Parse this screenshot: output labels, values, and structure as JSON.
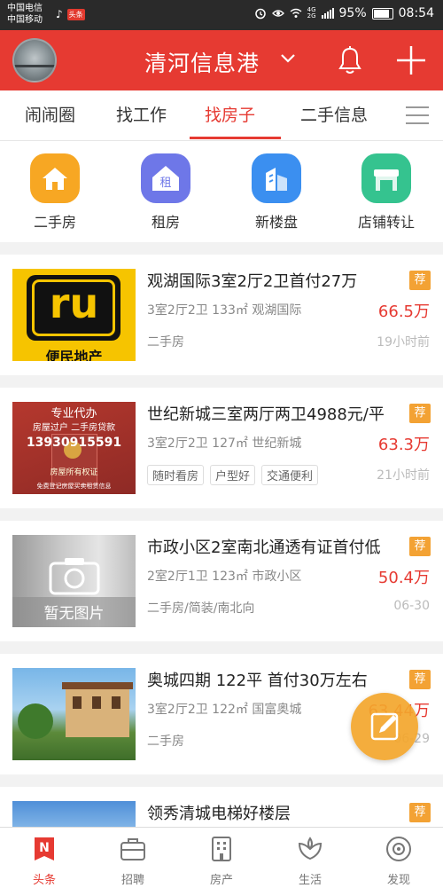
{
  "status_bar": {
    "carrier1": "中国电信",
    "carrier2": "中国移动",
    "app_badge": "头条",
    "net1": "4G",
    "net2": "2G",
    "battery": "95%",
    "time": "08:54"
  },
  "header": {
    "title": "清河信息港",
    "accent_color": "#e63a32"
  },
  "tabs": [
    {
      "label": "闹闹圈"
    },
    {
      "label": "找工作"
    },
    {
      "label": "找房子",
      "active": true
    },
    {
      "label": "二手信息"
    }
  ],
  "categories": [
    {
      "label": "二手房",
      "icon": "house-icon",
      "color": "#f7a723"
    },
    {
      "label": "租房",
      "icon": "rent-icon",
      "glyph": "租",
      "color": "#6e77e8"
    },
    {
      "label": "新楼盘",
      "icon": "building-icon",
      "color": "#3b8ff0"
    },
    {
      "label": "店铺转让",
      "icon": "shop-icon",
      "color": "#35c38f"
    }
  ],
  "listings": [
    {
      "title": "观湖国际3室2厅2卫首付27万",
      "badge": "荐",
      "spec": "3室2厅2卫  133㎡  观湖国际",
      "price": "66.5万",
      "type": "二手房",
      "time": "19小时前",
      "thumb_text": "ru",
      "thumb_caption": "便民地产"
    },
    {
      "title": "世纪新城三室两厅两卫4988元/平",
      "badge": "荐",
      "spec": "3室2厅2卫  127㎡  世纪新城",
      "price": "63.3万",
      "tags": [
        "随时看房",
        "户型好",
        "交通便利"
      ],
      "time": "21小时前",
      "thumb_lines": [
        "专业代办",
        "房屋过户 二手房贷款",
        "13930915591",
        "房屋所有权证",
        "免费登记房屋买卖租赁信息"
      ]
    },
    {
      "title": "市政小区2室南北通透有证首付低",
      "badge": "荐",
      "spec": "2室2厅1卫  123㎡  市政小区",
      "price": "50.4万",
      "type": "二手房/简装/南北向",
      "time": "06-30",
      "thumb_caption": "暂无图片"
    },
    {
      "title": "奥城四期 122平 首付30万左右",
      "badge": "荐",
      "spec": "3室2厅2卫  122㎡  国富奥城",
      "price": "63.44万",
      "type": "二手房",
      "time": "06-29"
    },
    {
      "title": "领秀清城电梯好楼层",
      "badge": "荐"
    }
  ],
  "bottom_nav": [
    {
      "label": "头条",
      "icon": "headline-icon",
      "active": true
    },
    {
      "label": "招聘",
      "icon": "briefcase-icon"
    },
    {
      "label": "房产",
      "icon": "building-icon"
    },
    {
      "label": "生活",
      "icon": "lotus-icon"
    },
    {
      "label": "发现",
      "icon": "eye-icon"
    }
  ]
}
